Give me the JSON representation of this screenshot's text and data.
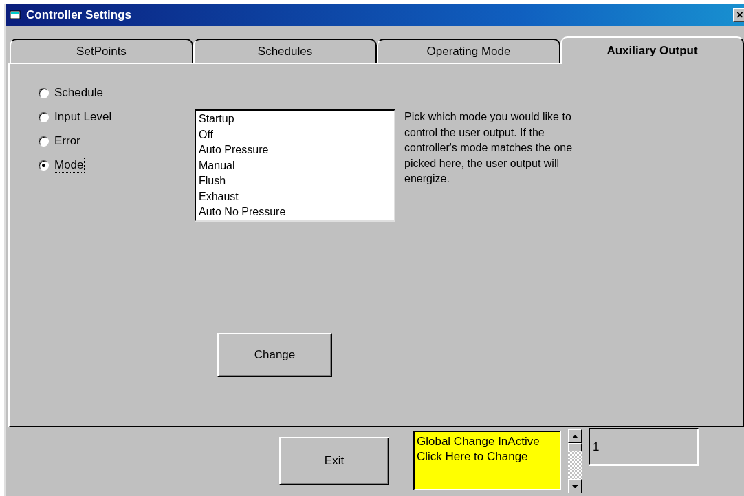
{
  "window": {
    "title": "Controller Settings",
    "close": "×"
  },
  "tabs": [
    {
      "label": "SetPoints",
      "selected": false
    },
    {
      "label": "Schedules",
      "selected": false
    },
    {
      "label": "Operating Mode",
      "selected": false
    },
    {
      "label": "Auxiliary Output",
      "selected": true
    }
  ],
  "radios": [
    {
      "label": "Schedule",
      "selected": false
    },
    {
      "label": "Input Level",
      "selected": false
    },
    {
      "label": "Error",
      "selected": false
    },
    {
      "label": "Mode",
      "selected": true
    }
  ],
  "mode_list": [
    "Startup",
    "Off",
    "Auto Pressure",
    "Manual",
    "Flush",
    "Exhaust",
    "Auto No Pressure"
  ],
  "description": "Pick which mode you would like to control the user output.  If the controller's mode matches the one picked here, the user output will energize.",
  "change_button": "Change",
  "exit_button": "Exit",
  "global_change": [
    "Global Change InActive",
    "Click Here to Change"
  ],
  "counter_field": {
    "value": "1"
  }
}
